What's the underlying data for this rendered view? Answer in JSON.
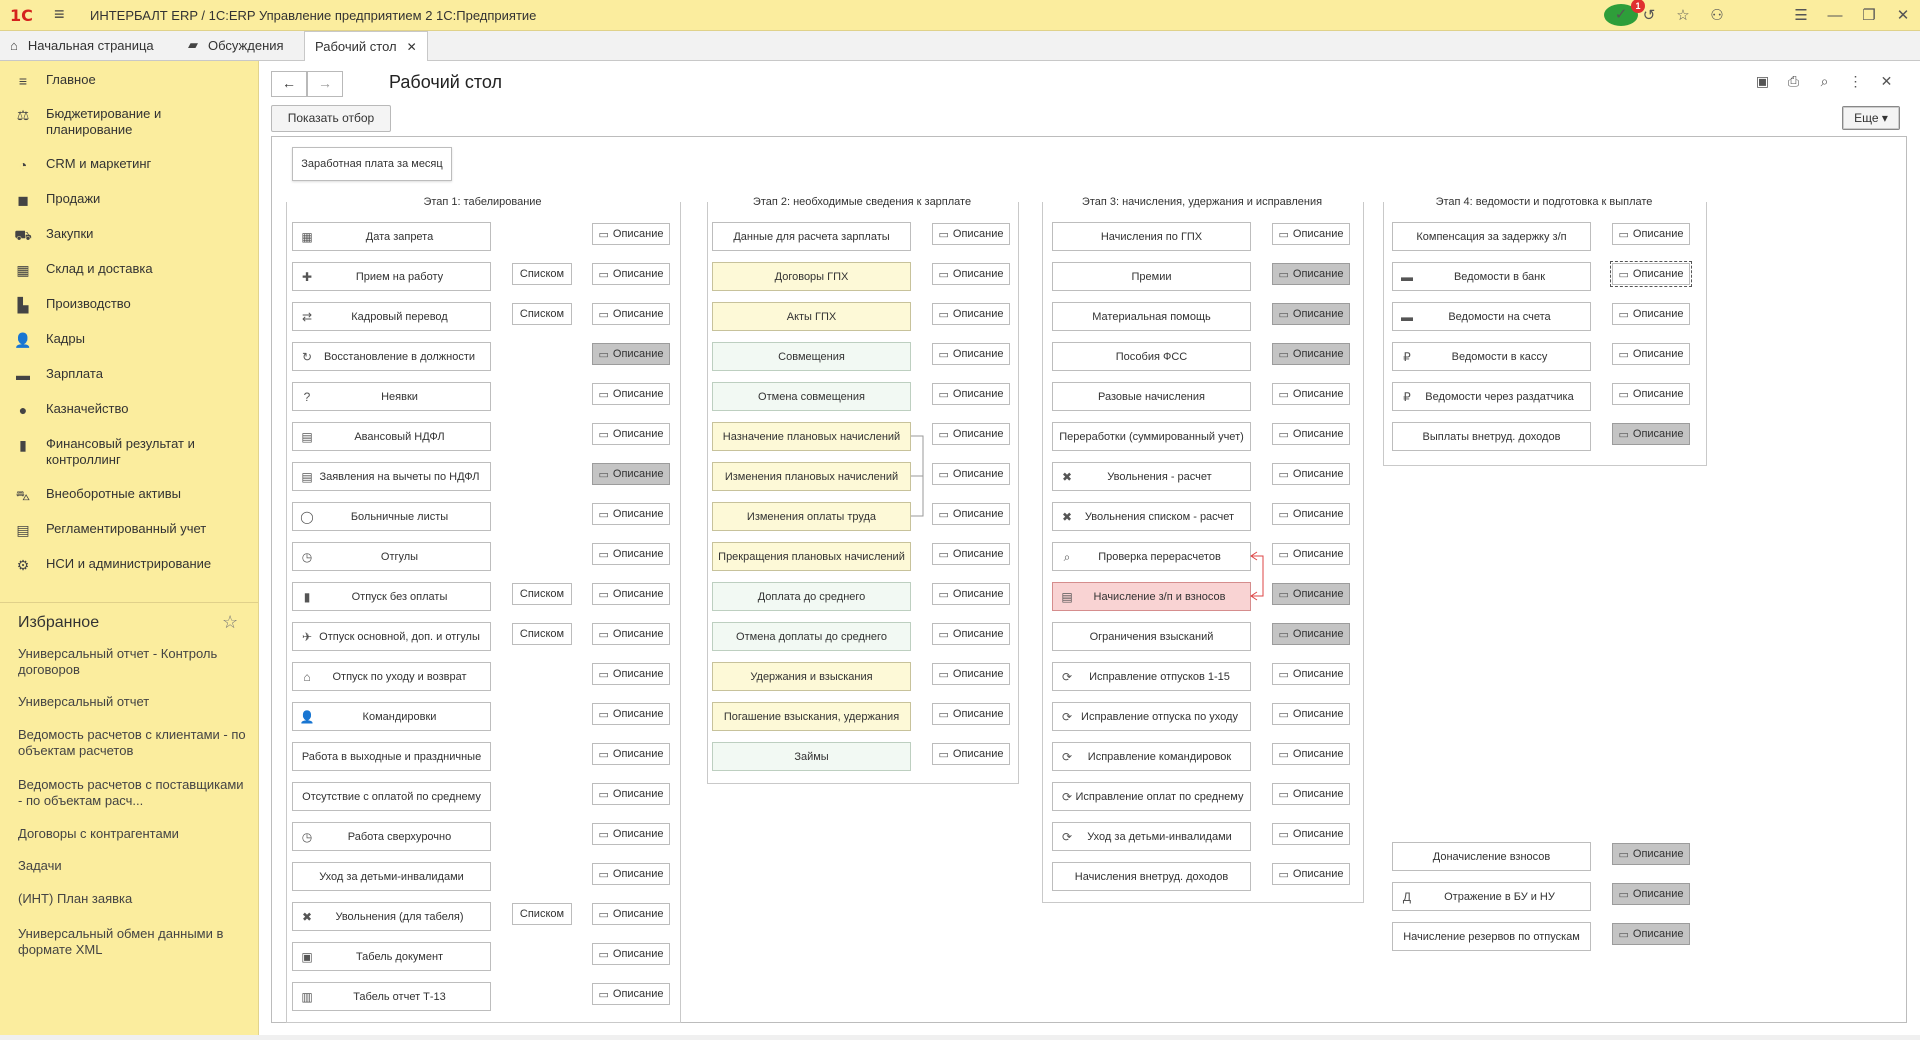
{
  "window": {
    "title": "ИНТЕРБАЛТ ERP / 1С:ERP Управление предприятием 2 1С:Предприятие",
    "logo": "1С",
    "notification_count": "1"
  },
  "tabs": [
    {
      "label": "Начальная страница",
      "icon": "home-icon"
    },
    {
      "label": "Обсуждения",
      "icon": "chat-icon"
    },
    {
      "label": "Рабочий стол",
      "icon": "",
      "active": true
    }
  ],
  "sidebar": {
    "items": [
      {
        "label": "Главное",
        "icon": "menu-icon"
      },
      {
        "label": "Бюджетирование и планирование",
        "icon": "budget-icon"
      },
      {
        "label": "CRM и маркетинг",
        "icon": "pie-icon"
      },
      {
        "label": "Продажи",
        "icon": "bag-icon"
      },
      {
        "label": "Закупки",
        "icon": "cart-icon"
      },
      {
        "label": "Склад и доставка",
        "icon": "grid-icon"
      },
      {
        "label": "Производство",
        "icon": "factory-icon"
      },
      {
        "label": "Кадры",
        "icon": "person-icon"
      },
      {
        "label": "Зарплата",
        "icon": "wallet-icon"
      },
      {
        "label": "Казначейство",
        "icon": "coin-icon"
      },
      {
        "label": "Финансовый результат и контроллинг",
        "icon": "chart-icon"
      },
      {
        "label": "Внеоборотные активы",
        "icon": "car-icon"
      },
      {
        "label": "Регламентированный учет",
        "icon": "report-icon"
      },
      {
        "label": "НСИ и администрирование",
        "icon": "gear-icon"
      }
    ],
    "favorites_title": "Избранное",
    "favorites": [
      "Универсальный отчет - Контроль договоров",
      "Универсальный отчет",
      "Ведомость расчетов с клиентами - по объектам расчетов",
      "Ведомость расчетов с поставщиками - по объектам расч...",
      "Договоры с контрагентами",
      "Задачи",
      "(ИНТ) План заявка",
      "Универсальный обмен данными в формате XML"
    ]
  },
  "page": {
    "title": "Рабочий стол",
    "show_filter": "Показать отбор",
    "more": "Еще",
    "selector": "Заработная плата за месяц",
    "desc_label": "Описание",
    "list_label": "Списком"
  },
  "stages": [
    {
      "title": "Этап 1: табелирование",
      "items": [
        {
          "label": "Дата запрета",
          "icon": "calendar-icon",
          "list": false,
          "desc_active": false
        },
        {
          "label": "Прием на работу",
          "icon": "person-add-icon",
          "list": true,
          "desc_active": false
        },
        {
          "label": "Кадровый перевод",
          "icon": "transfer-icon",
          "list": true,
          "desc_active": false
        },
        {
          "label": "Восстановление в должности",
          "icon": "person-restore-icon",
          "list": false,
          "desc_active": true
        },
        {
          "label": "Неявки",
          "icon": "person-question-icon",
          "list": false,
          "desc_active": false
        },
        {
          "label": "Авансовый НДФЛ",
          "icon": "document-icon",
          "list": false,
          "desc_active": false
        },
        {
          "label": "Заявления на вычеты по НДФЛ",
          "icon": "document-icon",
          "list": false,
          "desc_active": true
        },
        {
          "label": "Больничные листы",
          "icon": "person-outline-icon",
          "list": false,
          "desc_active": false
        },
        {
          "label": "Отгулы",
          "icon": "person-clock-icon",
          "list": false,
          "desc_active": false
        },
        {
          "label": "Отпуск без оплаты",
          "icon": "suitcase-icon",
          "list": true,
          "desc_active": false
        },
        {
          "label": "Отпуск основной, доп. и отгулы",
          "icon": "plane-icon",
          "list": true,
          "desc_active": false
        },
        {
          "label": "Отпуск по уходу и возврат",
          "icon": "house-icon",
          "list": false,
          "desc_active": false
        },
        {
          "label": "Командировки",
          "icon": "person-icon",
          "list": false,
          "desc_active": false
        },
        {
          "label": "Работа в выходные и праздничные",
          "icon": "",
          "list": false,
          "desc_active": false
        },
        {
          "label": "Отсутствие с оплатой по среднему",
          "icon": "",
          "list": false,
          "desc_active": false
        },
        {
          "label": "Работа сверхурочно",
          "icon": "person-clock-icon",
          "list": false,
          "desc_active": false
        },
        {
          "label": "Уход за детьми-инвалидами",
          "icon": "",
          "list": false,
          "desc_active": false
        },
        {
          "label": "Увольнения (для табеля)",
          "icon": "person-remove-icon",
          "list": true,
          "desc_active": false
        },
        {
          "label": "Табель документ",
          "icon": "sheet-icon",
          "list": false,
          "desc_active": false
        },
        {
          "label": "Табель отчет Т-13",
          "icon": "table-icon",
          "list": false,
          "desc_active": false
        }
      ]
    },
    {
      "title": "Этап 2: необходимые сведения к зарплате",
      "items": [
        {
          "label": "Данные для расчета зарплаты",
          "style": "white",
          "desc_active": false
        },
        {
          "label": "Договоры ГПХ",
          "style": "yellow",
          "desc_active": false
        },
        {
          "label": "Акты ГПХ",
          "style": "yellow",
          "desc_active": false
        },
        {
          "label": "Совмещения",
          "style": "green",
          "desc_active": false
        },
        {
          "label": "Отмена совмещения",
          "style": "green",
          "desc_active": false
        },
        {
          "label": "Назначение плановых начислений",
          "style": "yellow",
          "desc_active": false
        },
        {
          "label": "Изменения плановых начислений",
          "style": "yellow",
          "desc_active": false
        },
        {
          "label": "Изменения оплаты труда",
          "style": "yellow",
          "desc_active": false
        },
        {
          "label": "Прекращения плановых начислений",
          "style": "yellow",
          "desc_active": false
        },
        {
          "label": "Доплата до среднего",
          "style": "green",
          "desc_active": false
        },
        {
          "label": "Отмена доплаты до среднего",
          "style": "green",
          "desc_active": false
        },
        {
          "label": "Удержания и взыскания",
          "style": "yellow",
          "desc_active": false
        },
        {
          "label": "Погашение взыскания, удержания",
          "style": "yellow",
          "desc_active": false
        },
        {
          "label": "Займы",
          "style": "green",
          "desc_active": false
        }
      ]
    },
    {
      "title": "Этап 3: начисления, удержания и исправления",
      "items": [
        {
          "label": "Начисления по ГПХ",
          "icon": "",
          "style": "white",
          "desc_active": false
        },
        {
          "label": "Премии",
          "icon": "",
          "style": "white",
          "desc_active": true
        },
        {
          "label": "Материальная помощь",
          "icon": "",
          "style": "white",
          "desc_active": true
        },
        {
          "label": "Пособия ФСС",
          "icon": "",
          "style": "white",
          "desc_active": true
        },
        {
          "label": "Разовые начисления",
          "icon": "",
          "style": "white",
          "desc_active": false
        },
        {
          "label": "Переработки (суммированный учет)",
          "icon": "",
          "style": "white",
          "desc_active": false
        },
        {
          "label": "Увольнения - расчет",
          "icon": "person-remove-icon",
          "style": "white",
          "desc_active": false
        },
        {
          "label": "Увольнения списком - расчет",
          "icon": "person-remove-icon",
          "style": "white",
          "desc_active": false
        },
        {
          "label": "Проверка перерасчетов",
          "icon": "magnifier-icon",
          "style": "white",
          "desc_active": false
        },
        {
          "label": "Начисление з/п и взносов",
          "icon": "payroll-icon",
          "style": "pink",
          "desc_active": true
        },
        {
          "label": "Ограничения взысканий",
          "icon": "",
          "style": "white",
          "desc_active": true
        },
        {
          "label": "Исправление отпусков 1-15",
          "icon": "refresh-icon",
          "style": "white",
          "desc_active": false
        },
        {
          "label": "Исправление отпуска по уходу",
          "icon": "refresh-icon",
          "style": "white",
          "desc_active": false
        },
        {
          "label": "Исправление командировок",
          "icon": "refresh-icon",
          "style": "white",
          "desc_active": false
        },
        {
          "label": "Исправление оплат по среднему",
          "icon": "refresh-icon",
          "style": "white",
          "desc_active": false
        },
        {
          "label": "Уход за детьми-инвалидами",
          "icon": "refresh-icon",
          "style": "white",
          "desc_active": false
        },
        {
          "label": "Начисления внетруд. доходов",
          "icon": "",
          "style": "white",
          "desc_active": false
        }
      ]
    },
    {
      "title": "Этап 4: ведомости и подготовка к выплате",
      "items": [
        {
          "label": "Компенсация за задержку з/п",
          "icon": "",
          "desc_active": false,
          "focused": false
        },
        {
          "label": "Ведомости в банк",
          "icon": "card-icon",
          "desc_active": false,
          "focused": true
        },
        {
          "label": "Ведомости на счета",
          "icon": "card-icon",
          "desc_active": false,
          "focused": false
        },
        {
          "label": "Ведомости в кассу",
          "icon": "ruble-icon",
          "desc_active": false,
          "focused": false
        },
        {
          "label": "Ведомости через раздатчика",
          "icon": "ruble-icon",
          "desc_active": false,
          "focused": false
        },
        {
          "label": "Выплаты внетруд. доходов",
          "icon": "",
          "desc_active": true,
          "focused": false
        }
      ],
      "extra": [
        {
          "label": "Доначисление взносов",
          "icon": "",
          "desc_active": true
        },
        {
          "label": "Отражение в БУ и НУ",
          "icon": "dtkt-icon",
          "desc_active": true
        },
        {
          "label": "Начисление резервов по отпускам",
          "icon": "",
          "desc_active": true
        }
      ]
    }
  ]
}
